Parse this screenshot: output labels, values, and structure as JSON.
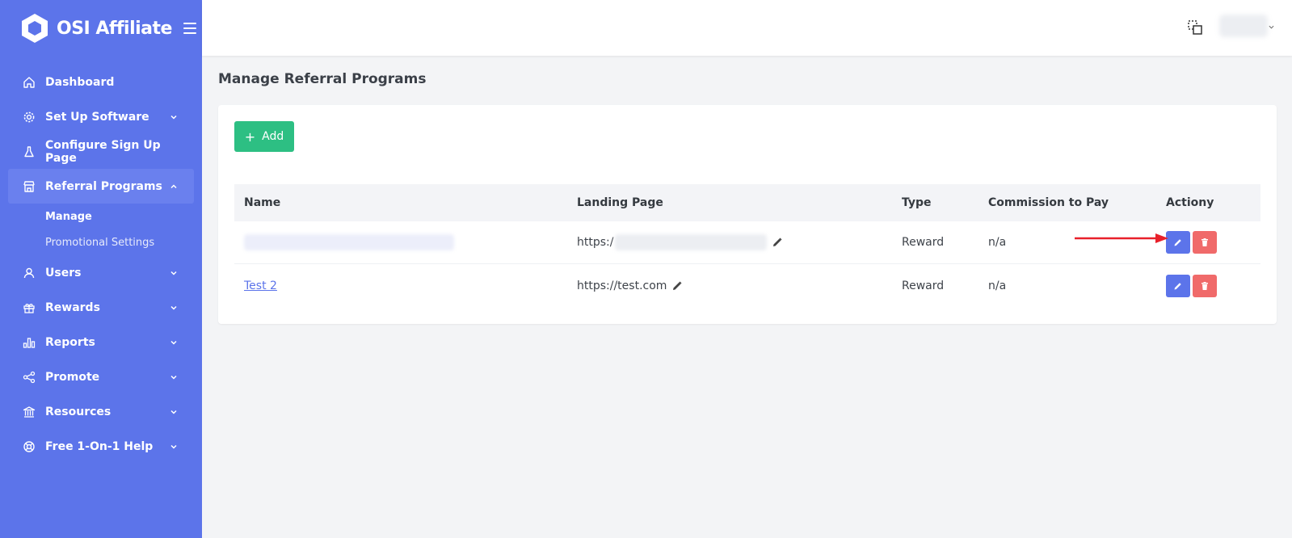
{
  "brand": {
    "name": "OSI Affiliate"
  },
  "sidebar": {
    "items": [
      {
        "label": "Dashboard",
        "icon": "home-icon"
      },
      {
        "label": "Set Up Software",
        "icon": "gear-icon",
        "expandable": true
      },
      {
        "label": "Configure Sign Up Page",
        "icon": "flask-icon"
      },
      {
        "label": "Referral Programs",
        "icon": "store-icon",
        "expandable": true,
        "expanded": true,
        "active": true
      },
      {
        "label": "Users",
        "icon": "user-icon",
        "expandable": true
      },
      {
        "label": "Rewards",
        "icon": "gift-icon",
        "expandable": true
      },
      {
        "label": "Reports",
        "icon": "chart-icon",
        "expandable": true
      },
      {
        "label": "Promote",
        "icon": "share-icon",
        "expandable": true
      },
      {
        "label": "Resources",
        "icon": "bank-icon",
        "expandable": true
      },
      {
        "label": "Free 1-On-1 Help",
        "icon": "lifebuoy-icon",
        "expandable": true
      }
    ],
    "subitems": [
      {
        "label": "Manage",
        "active": true
      },
      {
        "label": "Promotional Settings",
        "active": false
      }
    ]
  },
  "page": {
    "title": "Manage Referral Programs"
  },
  "toolbar": {
    "add_label": "Add"
  },
  "table": {
    "headers": [
      "Name",
      "Landing Page",
      "Type",
      "Commission to Pay",
      "Actiony"
    ],
    "rows": [
      {
        "name": "",
        "landing": "https:/",
        "type": "Reward",
        "commission": "n/a"
      },
      {
        "name": "Test 2",
        "landing": "https://test.com",
        "type": "Reward",
        "commission": "n/a"
      }
    ]
  },
  "colors": {
    "sidebar": "#5c74ea",
    "add": "#2dbf83",
    "edit": "#5c74ea",
    "delete": "#f06a6a",
    "arrow": "#e8202a"
  }
}
